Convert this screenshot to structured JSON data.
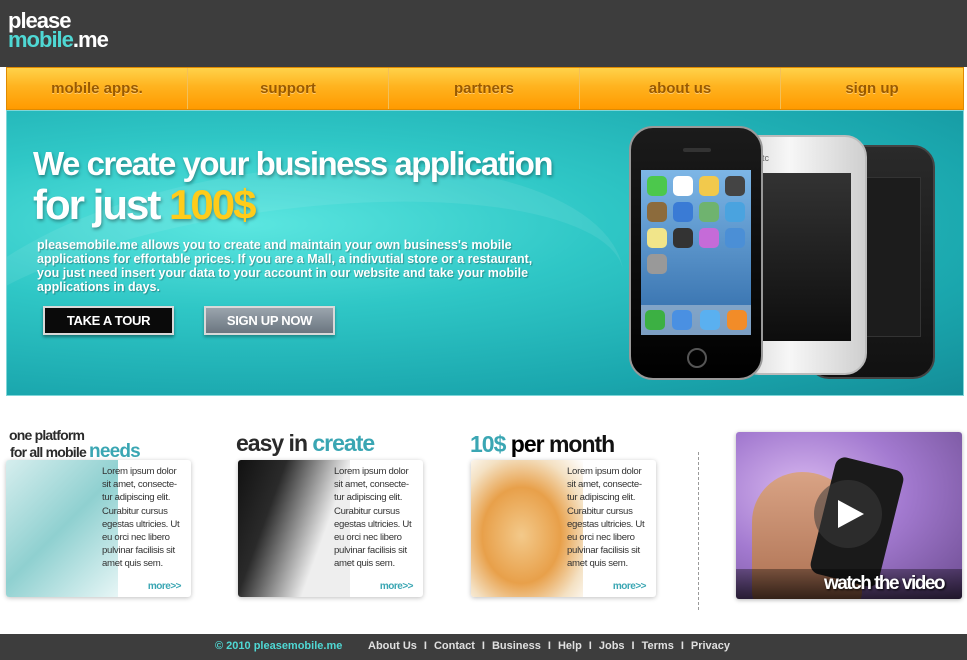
{
  "logo": {
    "line1": "please",
    "line2_main": "mobile",
    "line2_suffix": ".me"
  },
  "nav": {
    "items": [
      "mobile apps.",
      "support",
      "partners",
      "about us",
      "sign up"
    ]
  },
  "hero": {
    "headline_line1": "We create your business application",
    "headline_line2_prefix": "for just",
    "headline_price": "100$",
    "description": "pleasemobile.me allows you to create and maintain your own business's mobile applications for  effortable prices. If you are a Mall, a indivutial store or a restaurant, you just need insert your data to your account in our website and take your mobile applications in days.",
    "button_tour": "TAKE A TOUR",
    "button_signup": "SIGN UP NOW",
    "phone_brand": "htc"
  },
  "features": [
    {
      "title_line1": "one platform",
      "title_line2_prefix": "for all mobile",
      "title_line2_highlight": "needs",
      "text": "Lorem ipsum dolor sit amet, consecte-tur adipiscing elit. Curabitur cursus egestas ultricies. Ut eu orci nec libero pulvinar facilisis sit amet quis sem.",
      "more": "more>>"
    },
    {
      "title_prefix": "easy in",
      "title_highlight": "create",
      "text": "Lorem ipsum dolor sit amet, consecte-tur adipiscing elit. Curabitur cursus egestas ultricies. Ut eu orci nec libero pulvinar facilisis sit amet quis sem.",
      "more": "more>>"
    },
    {
      "title_highlight": "10$",
      "title_mid": "per",
      "title_suffix": "month",
      "text": "Lorem ipsum dolor sit amet, consecte-tur adipiscing elit. Curabitur cursus egestas ultricies. Ut eu orci nec libero pulvinar facilisis sit amet quis sem.",
      "more": "more>>"
    }
  ],
  "video": {
    "label": "watch the video",
    "icon": "play-icon"
  },
  "footer": {
    "copyright": "© 2010 pleasemobile.me",
    "links": [
      "About Us",
      "Contact",
      "Business",
      "Help",
      "Jobs",
      "Terms",
      "Privacy"
    ],
    "separator": "I"
  },
  "colors": {
    "header_bg": "#3d3d3d",
    "nav_orange": "#ffb31f",
    "accent_teal": "#3aa6b3",
    "hero_teal": "#2fc7c6",
    "price_yellow": "#ffcc1a"
  }
}
